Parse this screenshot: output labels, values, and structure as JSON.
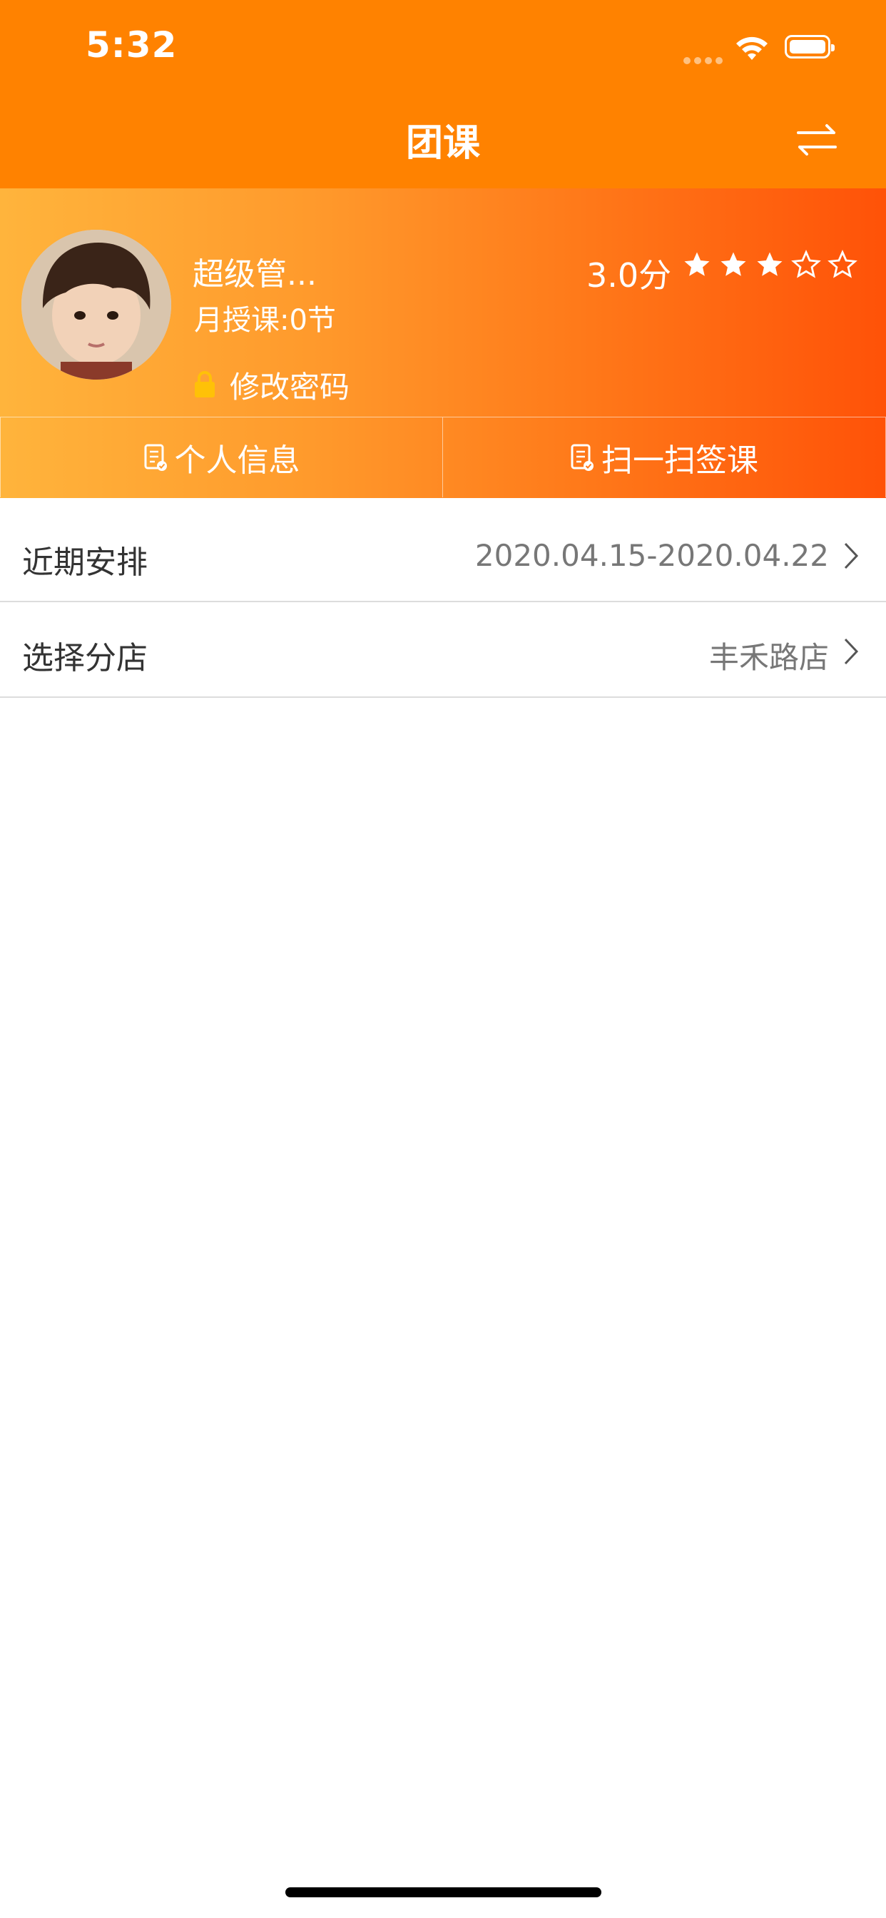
{
  "status_bar": {
    "time": "5:32"
  },
  "nav": {
    "title": "团课"
  },
  "profile": {
    "name": "超级管...",
    "monthly_classes": "月授课:0节",
    "change_password": "修改密码",
    "score": "3.0分",
    "rating": {
      "value": 3,
      "max": 5
    }
  },
  "actions": {
    "personal_info": "个人信息",
    "scan_checkin": "扫一扫签课"
  },
  "list": [
    {
      "label": "近期安排",
      "value": "2020.04.15-2020.04.22"
    },
    {
      "label": "选择分店",
      "value": "丰禾路店"
    }
  ],
  "colors": {
    "primary": "#FF8200",
    "gradient_start": "#FFB43C",
    "gradient_end": "#FF5208",
    "lock": "#FFC107"
  }
}
